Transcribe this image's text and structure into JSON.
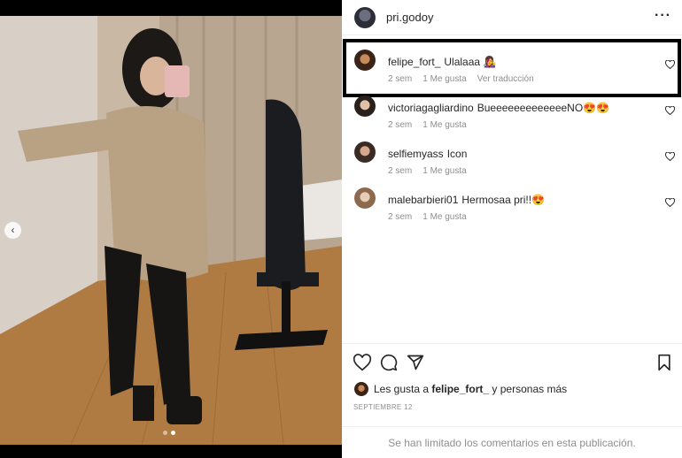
{
  "post": {
    "author": "pri.godoy",
    "carousel": {
      "slides": 2,
      "active_index": 1
    }
  },
  "comments": [
    {
      "user": "felipe_fort_",
      "text": "Ulalaaa 👩‍🎤",
      "time": "2 sem",
      "likes": "1 Me gusta",
      "translate": "Ver traducción",
      "highlighted": true
    },
    {
      "user": "victoriagagliardino",
      "text": "BueeeeeeeeeeeeeNO😍😍",
      "time": "2 sem",
      "likes": "1 Me gusta"
    },
    {
      "user": "selfiemyass",
      "text": "Icon",
      "time": "2 sem",
      "likes": "1 Me gusta"
    },
    {
      "user": "malebarbieri01",
      "text": "Hermosaa pri!!😍",
      "time": "2 sem",
      "likes": "1 Me gusta"
    }
  ],
  "likes_summary": {
    "prefix": "Les gusta a",
    "user": "felipe_fort_",
    "suffix": "y personas más"
  },
  "date": "SEPTIEMBRE 12",
  "footer": "Se han limitado los comentarios en esta publicación.",
  "icons": {
    "like": "heart-icon",
    "comment": "comment-icon",
    "share": "share-icon",
    "save": "bookmark-icon",
    "more": "more-icon",
    "prev": "chevron-left-icon"
  }
}
